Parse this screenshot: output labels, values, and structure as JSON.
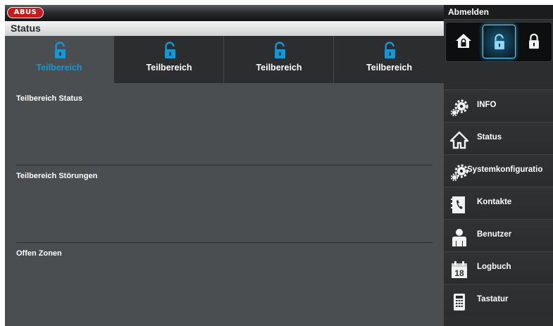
{
  "brand": {
    "logo_text": "ABUS"
  },
  "header": {
    "title": "Status"
  },
  "tabs": [
    {
      "label": "Teilbereich",
      "active": true
    },
    {
      "label": "Teilbereich",
      "active": false
    },
    {
      "label": "Teilbereich",
      "active": false
    },
    {
      "label": "Teilbereich",
      "active": false
    }
  ],
  "sections": [
    {
      "title": "Teilbereich Status"
    },
    {
      "title": "Teilbereich Störungen"
    },
    {
      "title": "Offen Zonen"
    }
  ],
  "sidebar": {
    "logout_label": "Abmelden",
    "modes": [
      {
        "icon": "house-lock-icon",
        "active": false
      },
      {
        "icon": "lock-open-icon",
        "active": true
      },
      {
        "icon": "lock-closed-icon",
        "active": false
      }
    ],
    "menu": [
      {
        "label": "INFO",
        "icon": "gears-icon"
      },
      {
        "label": "Status",
        "icon": "house-icon"
      },
      {
        "label": "Systemkonfiguratio",
        "icon": "gears-icon"
      },
      {
        "label": "Kontakte",
        "icon": "phonebook-icon"
      },
      {
        "label": "Benutzer",
        "icon": "user-icon"
      },
      {
        "label": "Logbuch",
        "icon": "calendar-icon"
      },
      {
        "label": "Tastatur",
        "icon": "keypad-icon"
      }
    ]
  },
  "colors": {
    "accent": "#1796d6",
    "panel": "#4b4e50",
    "dark": "#2b2d2f"
  }
}
